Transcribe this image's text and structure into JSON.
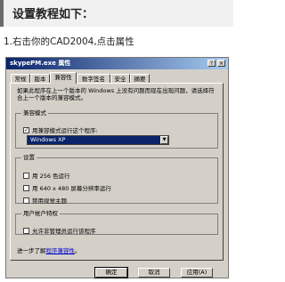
{
  "tutorial": {
    "heading": "设置教程如下：",
    "step1": "1.右击你的CAD2004,点击属性"
  },
  "dialog": {
    "title": "skypePM.exe 属性",
    "title_buttons": [
      "?",
      "×"
    ],
    "tabs": [
      "常规",
      "版本",
      "兼容性",
      "数字签名",
      "安全",
      "摘要"
    ],
    "active_tab": "兼容性",
    "description": "如果此程序在上一个版本的 Windows 上没有问题而现在出现问题，请选择符合上一个版本的兼容模式。",
    "compat_mode": {
      "group_label": "兼容模式",
      "checkbox_label": "用兼容模式运行这个程序:",
      "checked": true,
      "selected_os": "Windows XP"
    },
    "settings": {
      "group_label": "设置",
      "items": [
        {
          "label": "用 256 色运行",
          "checked": false
        },
        {
          "label": "用 640 x 480 屏幕分辨率运行",
          "checked": false
        },
        {
          "label": "禁用视觉主题",
          "checked": false
        }
      ]
    },
    "privilege": {
      "group_label": "用户帐户特权",
      "item": {
        "label": "允许非管理员运行该程序",
        "checked": false
      }
    },
    "learn_more_prefix": "进一步了解",
    "learn_more_link": "程序兼容性",
    "learn_more_suffix": "。",
    "buttons": {
      "ok": "确定",
      "cancel": "取消",
      "apply": "应用(A)"
    },
    "check_mark": "✓"
  },
  "icons": {
    "dropdown": "chevron-down-icon"
  }
}
